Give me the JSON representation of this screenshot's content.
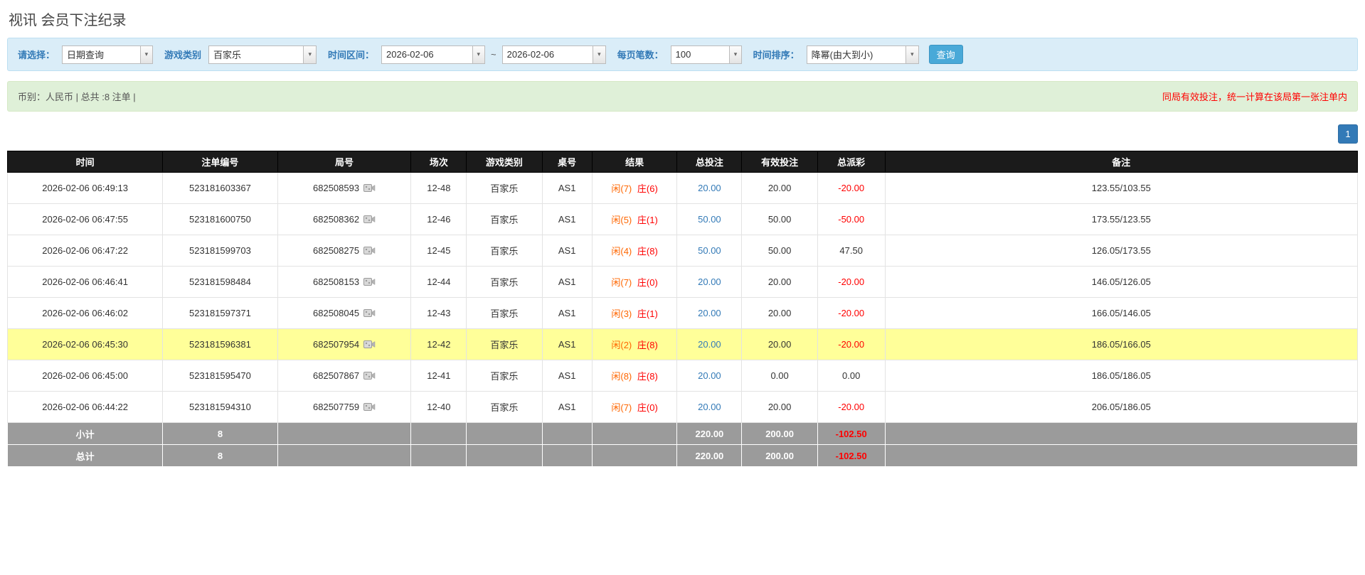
{
  "page": {
    "title": "视讯 会员下注纪录"
  },
  "colors": {
    "accent": "#337ab7",
    "link": "#337ab7",
    "red": "#ff0000",
    "player": "#ff6600",
    "banker": "#ff0000",
    "highlight": "#ffff99",
    "btn-blue": "#49a9d8"
  },
  "filters": {
    "select_label": "请选择：",
    "select_value": "日期查询",
    "game_type_label": "游戏类别",
    "game_type_value": "百家乐",
    "time_range_label": "时间区间：",
    "date_from": "2026-02-06",
    "tilde": "~",
    "date_to": "2026-02-06",
    "page_size_label": "每页笔数：",
    "page_size_value": "100",
    "sort_label": "时间排序：",
    "sort_value": "降幂(由大到小)",
    "search_button": "查询"
  },
  "summary": {
    "left": "币别：人民币 | 总共 :8 注单 |",
    "right": "同局有效投注，统一计算在该局第一张注单内"
  },
  "pagination": {
    "page": "1"
  },
  "table": {
    "headers": {
      "time": "时间",
      "order_id": "注单编号",
      "round_id": "局号",
      "session": "场次",
      "game_type": "游戏类别",
      "table_no": "桌号",
      "result": "结果",
      "total_bet": "总投注",
      "valid_bet": "有效投注",
      "payout": "总派彩",
      "note": "备注"
    },
    "rows": [
      {
        "time": "2026-02-06 06:49:13",
        "order_id": "523181603367",
        "round_id": "682508593",
        "session": "12-48",
        "game_type": "百家乐",
        "table_no": "AS1",
        "result_player": "闲(7)",
        "result_banker": "庄(6)",
        "total_bet": "20.00",
        "valid_bet": "20.00",
        "payout": "-20.00",
        "note": "123.55/103.55",
        "highlighted": false
      },
      {
        "time": "2026-02-06 06:47:55",
        "order_id": "523181600750",
        "round_id": "682508362",
        "session": "12-46",
        "game_type": "百家乐",
        "table_no": "AS1",
        "result_player": "闲(5)",
        "result_banker": "庄(1)",
        "total_bet": "50.00",
        "valid_bet": "50.00",
        "payout": "-50.00",
        "note": "173.55/123.55",
        "highlighted": false
      },
      {
        "time": "2026-02-06 06:47:22",
        "order_id": "523181599703",
        "round_id": "682508275",
        "session": "12-45",
        "game_type": "百家乐",
        "table_no": "AS1",
        "result_player": "闲(4)",
        "result_banker": "庄(8)",
        "total_bet": "50.00",
        "valid_bet": "50.00",
        "payout": "47.50",
        "note": "126.05/173.55",
        "highlighted": false
      },
      {
        "time": "2026-02-06 06:46:41",
        "order_id": "523181598484",
        "round_id": "682508153",
        "session": "12-44",
        "game_type": "百家乐",
        "table_no": "AS1",
        "result_player": "闲(7)",
        "result_banker": "庄(0)",
        "total_bet": "20.00",
        "valid_bet": "20.00",
        "payout": "-20.00",
        "note": "146.05/126.05",
        "highlighted": false
      },
      {
        "time": "2026-02-06 06:46:02",
        "order_id": "523181597371",
        "round_id": "682508045",
        "session": "12-43",
        "game_type": "百家乐",
        "table_no": "AS1",
        "result_player": "闲(3)",
        "result_banker": "庄(1)",
        "total_bet": "20.00",
        "valid_bet": "20.00",
        "payout": "-20.00",
        "note": "166.05/146.05",
        "highlighted": false
      },
      {
        "time": "2026-02-06 06:45:30",
        "order_id": "523181596381",
        "round_id": "682507954",
        "session": "12-42",
        "game_type": "百家乐",
        "table_no": "AS1",
        "result_player": "闲(2)",
        "result_banker": "庄(8)",
        "total_bet": "20.00",
        "valid_bet": "20.00",
        "payout": "-20.00",
        "note": "186.05/166.05",
        "highlighted": true
      },
      {
        "time": "2026-02-06 06:45:00",
        "order_id": "523181595470",
        "round_id": "682507867",
        "session": "12-41",
        "game_type": "百家乐",
        "table_no": "AS1",
        "result_player": "闲(8)",
        "result_banker": "庄(8)",
        "total_bet": "20.00",
        "valid_bet": "0.00",
        "payout": "0.00",
        "note": "186.05/186.05",
        "highlighted": false
      },
      {
        "time": "2026-02-06 06:44:22",
        "order_id": "523181594310",
        "round_id": "682507759",
        "session": "12-40",
        "game_type": "百家乐",
        "table_no": "AS1",
        "result_player": "闲(7)",
        "result_banker": "庄(0)",
        "total_bet": "20.00",
        "valid_bet": "20.00",
        "payout": "-20.00",
        "note": "206.05/186.05",
        "highlighted": false
      }
    ],
    "subtotal": {
      "label": "小计",
      "count": "8",
      "total_bet": "220.00",
      "valid_bet": "200.00",
      "payout": "-102.50"
    },
    "total": {
      "label": "总计",
      "count": "8",
      "total_bet": "220.00",
      "valid_bet": "200.00",
      "payout": "-102.50"
    }
  }
}
